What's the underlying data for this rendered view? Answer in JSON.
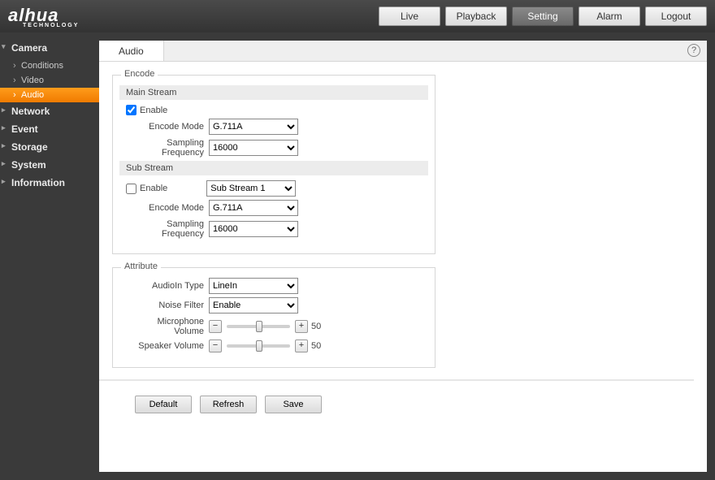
{
  "brand": {
    "name": "alhua",
    "sub": "TECHNOLOGY"
  },
  "nav": {
    "live": "Live",
    "playback": "Playback",
    "setting": "Setting",
    "alarm": "Alarm",
    "logout": "Logout"
  },
  "sidebar": {
    "camera": "Camera",
    "conditions": "Conditions",
    "video": "Video",
    "audio": "Audio",
    "network": "Network",
    "event": "Event",
    "storage": "Storage",
    "system": "System",
    "information": "Information"
  },
  "tab": "Audio",
  "encode": {
    "legend": "Encode",
    "main_hdr": "Main Stream",
    "main_enable_label": "Enable",
    "main_enable": true,
    "main_mode_label": "Encode Mode",
    "main_mode": "G.711A",
    "main_freq_label": "Sampling Frequency",
    "main_freq": "16000",
    "sub_hdr": "Sub Stream",
    "sub_enable_label": "Enable",
    "sub_enable": false,
    "sub_select": "Sub Stream 1",
    "sub_mode_label": "Encode Mode",
    "sub_mode": "G.711A",
    "sub_freq_label": "Sampling Frequency",
    "sub_freq": "16000"
  },
  "attr": {
    "legend": "Attribute",
    "audioin_label": "AudioIn Type",
    "audioin": "LineIn",
    "noise_label": "Noise Filter",
    "noise": "Enable",
    "mic_label": "Microphone Volume",
    "mic_val": "50",
    "spk_label": "Speaker Volume",
    "spk_val": "50"
  },
  "buttons": {
    "default": "Default",
    "refresh": "Refresh",
    "save": "Save"
  }
}
